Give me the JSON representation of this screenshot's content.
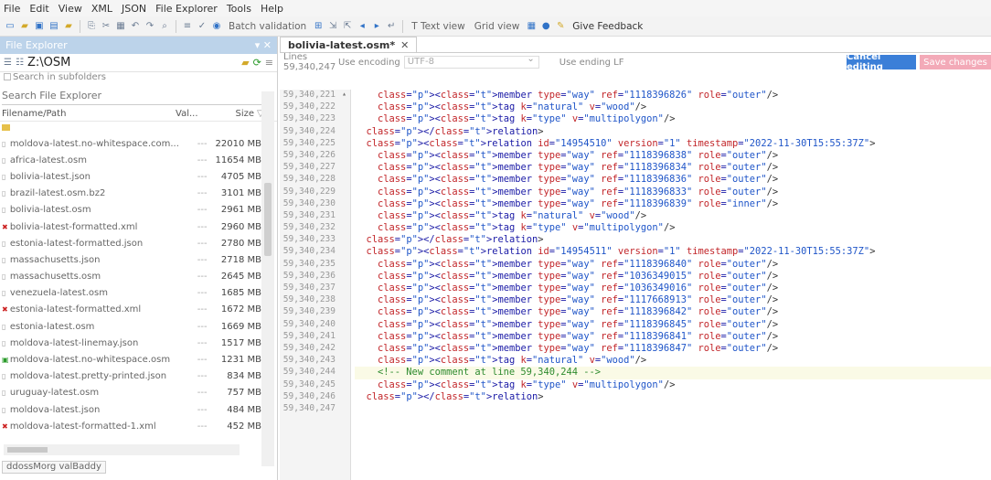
{
  "menu": [
    "File",
    "Edit",
    "View",
    "XML",
    "JSON",
    "File Explorer",
    "Tools",
    "Help"
  ],
  "toolbar": {
    "batch_validation": "Batch validation",
    "text_view": "T Text view",
    "grid_view": "Grid view",
    "give_feedback": "Give Feedback"
  },
  "left_panel": {
    "title": "File Explorer",
    "path": "Z:\\OSM",
    "search_subfolders": "Search in subfolders",
    "search_placeholder": "Search File Explorer",
    "col_name": "Filename/Path",
    "col_val": "Val...",
    "col_size": "Size",
    "files": [
      {
        "name": "moldova-latest.no-whitespace.com...",
        "val": "---",
        "size": "22010 MB",
        "mark": ""
      },
      {
        "name": "africa-latest.osm",
        "val": "---",
        "size": "11654 MB",
        "mark": ""
      },
      {
        "name": "bolivia-latest.json",
        "val": "---",
        "size": "4705 MB",
        "mark": ""
      },
      {
        "name": "brazil-latest.osm.bz2",
        "val": "---",
        "size": "3101 MB",
        "mark": ""
      },
      {
        "name": "bolivia-latest.osm",
        "val": "---",
        "size": "2961 MB",
        "mark": ""
      },
      {
        "name": "bolivia-latest-formatted.xml",
        "val": "---",
        "size": "2960 MB",
        "mark": "x"
      },
      {
        "name": "estonia-latest-formatted.json",
        "val": "---",
        "size": "2780 MB",
        "mark": ""
      },
      {
        "name": "massachusetts.json",
        "val": "---",
        "size": "2718 MB",
        "mark": ""
      },
      {
        "name": "massachusetts.osm",
        "val": "---",
        "size": "2645 MB",
        "mark": ""
      },
      {
        "name": "venezuela-latest.osm",
        "val": "---",
        "size": "1685 MB",
        "mark": ""
      },
      {
        "name": "estonia-latest-formatted.xml",
        "val": "---",
        "size": "1672 MB",
        "mark": "x"
      },
      {
        "name": "estonia-latest.osm",
        "val": "---",
        "size": "1669 MB",
        "mark": ""
      },
      {
        "name": "moldova-latest-linemay.json",
        "val": "---",
        "size": "1517 MB",
        "mark": ""
      },
      {
        "name": "moldova-latest.no-whitespace.osm",
        "val": "---",
        "size": "1231 MB",
        "mark": "g"
      },
      {
        "name": "moldova-latest.pretty-printed.json",
        "val": "---",
        "size": "834 MB",
        "mark": ""
      },
      {
        "name": "uruguay-latest.osm",
        "val": "---",
        "size": "757 MB",
        "mark": ""
      },
      {
        "name": "moldova-latest.json",
        "val": "---",
        "size": "484 MB",
        "mark": ""
      },
      {
        "name": "moldova-latest-formatted-1.xml",
        "val": "---",
        "size": "452 MB",
        "mark": "x"
      }
    ],
    "bottom_tab": "ddossMorg valBaddy"
  },
  "editor": {
    "tab_label": "bolivia-latest.osm*",
    "lines_info": "Lines 59,340,247",
    "encoding_label": "Use encoding",
    "encoding_value": "UTF-8",
    "line_ending": "Use ending LF",
    "cancel_label": "Cancel editing",
    "save_label": "Save changes",
    "line_numbers": [
      "59,340,221",
      "59,340,222",
      "59,340,223",
      "59,340,224",
      "59,340,225",
      "59,340,226",
      "59,340,227",
      "59,340,228",
      "59,340,229",
      "59,340,230",
      "59,340,231",
      "59,340,232",
      "59,340,233",
      "59,340,234",
      "59,340,235",
      "59,340,236",
      "59,340,237",
      "59,340,238",
      "59,340,239",
      "59,340,240",
      "59,340,241",
      "59,340,242",
      "59,340,243",
      "59,340,244",
      "59,340,245",
      "59,340,246",
      "59,340,247"
    ],
    "code_lines": [
      "    <member type=\"way\" ref=\"1118396826\" role=\"outer\"/>",
      "    <tag k=\"natural\" v=\"wood\"/>",
      "    <tag k=\"type\" v=\"multipolygon\"/>",
      "  </relation>",
      "  <relation id=\"14954510\" version=\"1\" timestamp=\"2022-11-30T15:55:37Z\">",
      "    <member type=\"way\" ref=\"1118396838\" role=\"outer\"/>",
      "    <member type=\"way\" ref=\"1118396834\" role=\"outer\"/>",
      "    <member type=\"way\" ref=\"1118396836\" role=\"outer\"/>",
      "    <member type=\"way\" ref=\"1118396833\" role=\"outer\"/>",
      "    <member type=\"way\" ref=\"1118396839\" role=\"inner\"/>",
      "    <tag k=\"natural\" v=\"wood\"/>",
      "    <tag k=\"type\" v=\"multipolygon\"/>",
      "  </relation>",
      "  <relation id=\"14954511\" version=\"1\" timestamp=\"2022-11-30T15:55:37Z\">",
      "    <member type=\"way\" ref=\"1118396840\" role=\"outer\"/>",
      "    <member type=\"way\" ref=\"1036349015\" role=\"outer\"/>",
      "    <member type=\"way\" ref=\"1036349016\" role=\"outer\"/>",
      "    <member type=\"way\" ref=\"1117668913\" role=\"outer\"/>",
      "    <member type=\"way\" ref=\"1118396842\" role=\"outer\"/>",
      "    <member type=\"way\" ref=\"1118396845\" role=\"outer\"/>",
      "    <member type=\"way\" ref=\"1118396841\" role=\"outer\"/>",
      "    <member type=\"way\" ref=\"1118396847\" role=\"outer\"/>",
      "    <tag k=\"natural\" v=\"wood\"/>",
      "    <!-- New comment at line 59,340,244 -->",
      "    <tag k=\"type\" v=\"multipolygon\"/>",
      "  </relation>",
      ""
    ]
  }
}
